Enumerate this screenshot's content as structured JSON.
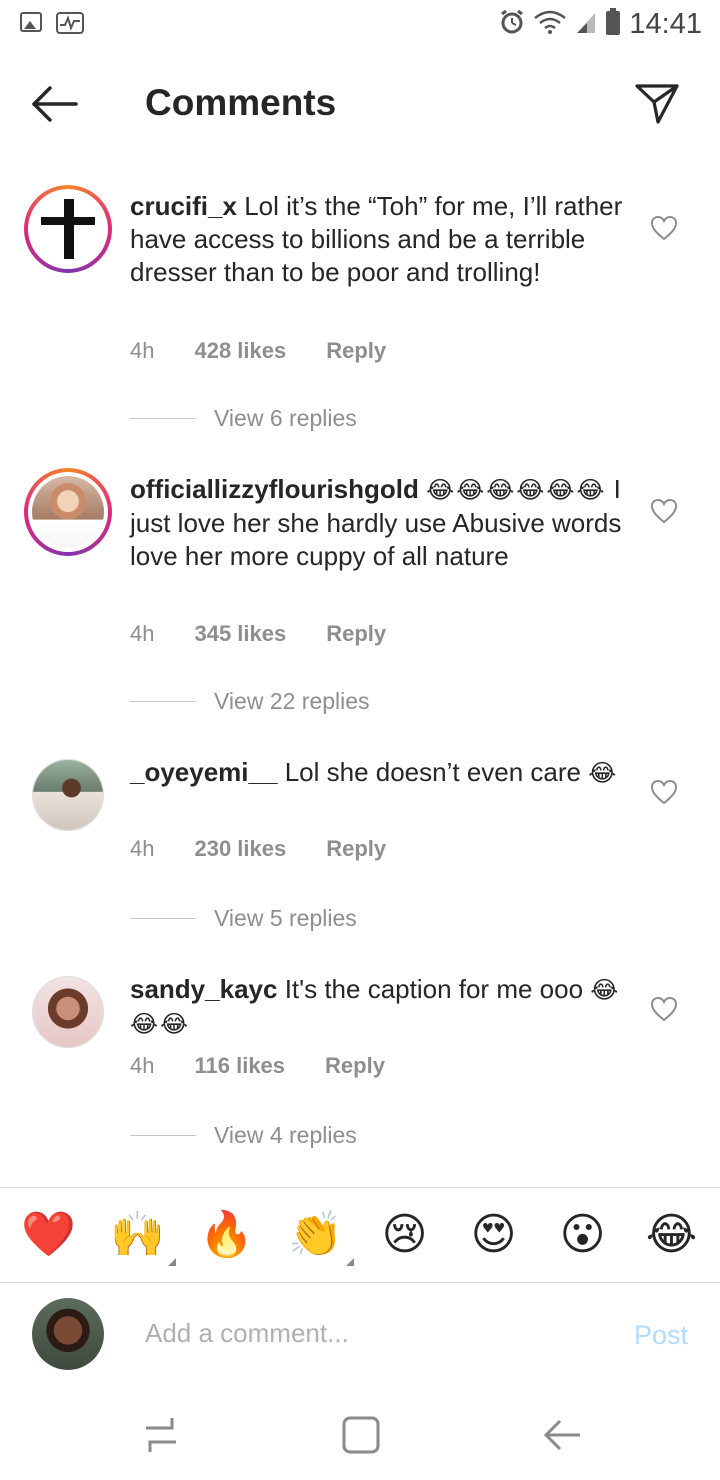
{
  "status_bar": {
    "time": "14:41"
  },
  "header": {
    "title": "Comments"
  },
  "comments": [
    {
      "username": "crucifi_x",
      "text": "Lol it’s the “Toh”  for me, I’ll rather have access to billions and be a terrible dresser than to be poor and trolling!",
      "emojis": "",
      "time": "4h",
      "likes": "428 likes",
      "reply": "Reply",
      "view_replies": "View 6 replies"
    },
    {
      "username": "officiallizzyflourishgold",
      "text": "I just love her she hardly use Abusive words love her more cuppy of all nature",
      "emojis": "😂😂😂😂😂😂",
      "time": "4h",
      "likes": "345 likes",
      "reply": "Reply",
      "view_replies": "View 22 replies"
    },
    {
      "username": "_oyeyemi__",
      "text": "Lol she doesn’t even care",
      "emojis": "😂",
      "time": "4h",
      "likes": "230 likes",
      "reply": "Reply",
      "view_replies": "View 5 replies"
    },
    {
      "username": "sandy_kayc",
      "text": "It's the caption for me ooo",
      "emojis": "😂😂😂",
      "time": "4h",
      "likes": "116 likes",
      "reply": "Reply",
      "view_replies": "View 4 replies"
    }
  ],
  "reactions": [
    "❤️",
    "🙌",
    "🔥",
    "👏",
    "😢",
    "😍",
    "😮",
    "😂"
  ],
  "add_comment": {
    "placeholder": "Add a comment...",
    "post_label": "Post"
  },
  "colors": {
    "accent": "#b3dbff",
    "meta": "#8e8e8e",
    "text": "#262626"
  }
}
